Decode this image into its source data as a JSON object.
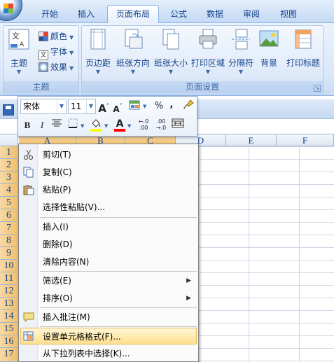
{
  "tabs": [
    {
      "label": "开始",
      "active": false
    },
    {
      "label": "插入",
      "active": false
    },
    {
      "label": "页面布局",
      "active": true
    },
    {
      "label": "公式",
      "active": false
    },
    {
      "label": "数据",
      "active": false
    },
    {
      "label": "审阅",
      "active": false
    },
    {
      "label": "视图",
      "active": false
    }
  ],
  "ribbon": {
    "theme_group": {
      "label": "主题",
      "themes_button": "主题",
      "colors": "颜色",
      "fonts": "字体",
      "effects": "效果"
    },
    "page_setup_group": {
      "label": "页面设置",
      "buttons": [
        "页边距",
        "纸张方向",
        "纸张大小",
        "打印区域",
        "分隔符",
        "背景",
        "打印标题"
      ]
    }
  },
  "mini_toolbar": {
    "font_name": "宋体",
    "font_size": "11",
    "grow_font": "A",
    "shrink_font": "A",
    "percent": "%",
    "comma": ",",
    "bold": "B",
    "italic": "I",
    "font_color_letter": "A",
    "increase_decimal": "←.0 .00",
    "decrease_decimal": ".00 →.0",
    "colors": {
      "fill": "#ffff00",
      "font": "#ff0000"
    }
  },
  "grid": {
    "columns": [
      "A",
      "B",
      "C",
      "D",
      "E",
      "F"
    ],
    "rows": [
      "1",
      "2",
      "3",
      "4",
      "5",
      "6",
      "7",
      "8",
      "9",
      "10",
      "11",
      "12",
      "13",
      "14",
      "15",
      "16",
      "17"
    ]
  },
  "context_menu": {
    "items": [
      {
        "label": "剪切(T)",
        "icon": "scissors-icon"
      },
      {
        "label": "复制(C)",
        "icon": "copy-icon"
      },
      {
        "label": "粘贴(P)",
        "icon": "paste-icon"
      },
      {
        "label": "选择性粘贴(V)...",
        "icon": ""
      },
      {
        "label": "插入(I)",
        "icon": ""
      },
      {
        "label": "删除(D)",
        "icon": ""
      },
      {
        "label": "清除内容(N)",
        "icon": ""
      },
      {
        "label": "筛选(E)",
        "icon": "",
        "submenu": true
      },
      {
        "label": "排序(O)",
        "icon": "",
        "submenu": true
      },
      {
        "label": "插入批注(M)",
        "icon": "comment-icon"
      },
      {
        "label": "设置单元格格式(F)...",
        "icon": "format-cells-icon",
        "highlighted": true
      },
      {
        "label": "从下拉列表中选择(K)...",
        "icon": ""
      }
    ]
  }
}
